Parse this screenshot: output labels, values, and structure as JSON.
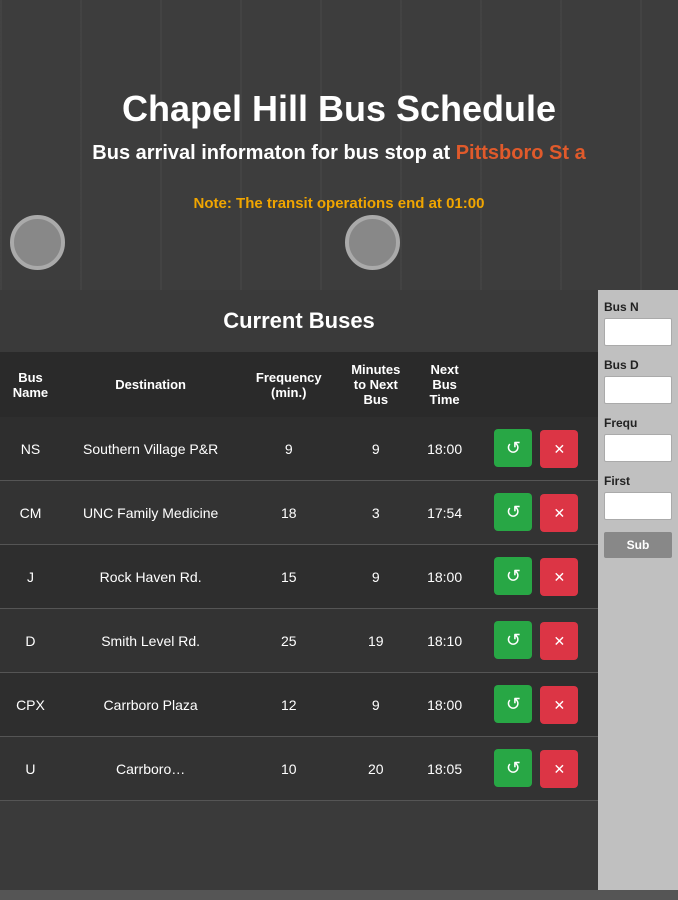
{
  "header": {
    "title": "Chapel Hill Bus Schedule",
    "subtitle": "Bus arrival informaton for bus stop at",
    "stop_name": "Pittsboro St a",
    "note": "Note: The transit operations end at 01:00"
  },
  "left_panel": {
    "title": "Current Buses",
    "table": {
      "columns": [
        "Bus Name",
        "Destination",
        "Frequency (min.)",
        "Minutes to Next Bus",
        "Next Bus Time"
      ],
      "rows": [
        {
          "bus_name": "NS",
          "destination": "Southern Village P&R",
          "frequency": "9",
          "minutes_to_next": "9",
          "next_bus_time": "18:00"
        },
        {
          "bus_name": "CM",
          "destination": "UNC Family Medicine",
          "frequency": "18",
          "minutes_to_next": "3",
          "next_bus_time": "17:54"
        },
        {
          "bus_name": "J",
          "destination": "Rock Haven Rd.",
          "frequency": "15",
          "minutes_to_next": "9",
          "next_bus_time": "18:00"
        },
        {
          "bus_name": "D",
          "destination": "Smith Level Rd.",
          "frequency": "25",
          "minutes_to_next": "19",
          "next_bus_time": "18:10"
        },
        {
          "bus_name": "CPX",
          "destination": "Carrboro Plaza",
          "frequency": "12",
          "minutes_to_next": "9",
          "next_bus_time": "18:00"
        },
        {
          "bus_name": "U",
          "destination": "Carrboro…",
          "frequency": "10",
          "minutes_to_next": "20",
          "next_bus_time": "18:05"
        }
      ]
    }
  },
  "right_panel": {
    "labels": {
      "bus_name": "Bus N",
      "bus_destination": "Bus D",
      "frequency": "Frequ",
      "first": "First",
      "submit": "Sub"
    }
  },
  "colors": {
    "refresh_btn": "#28a745",
    "delete_btn": "#dc3545",
    "stop_name": "#e05a2b",
    "note": "#f0a500"
  }
}
